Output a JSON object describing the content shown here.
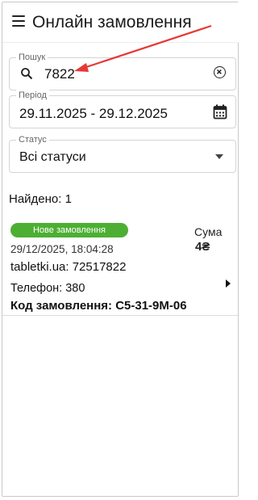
{
  "app": {
    "title": "Онлайн замовлення"
  },
  "search": {
    "label": "Пошук",
    "value": "7822"
  },
  "period": {
    "label": "Період",
    "value": "29.11.2025 - 29.12.2025"
  },
  "status": {
    "label": "Статус",
    "value": "Всі статуси"
  },
  "results": {
    "found_text": "Найдено: 1"
  },
  "orders": [
    {
      "badge": "Нове замовлення",
      "badge_color": "#4caf33",
      "datetime": "29/12/2025, 18:04:28",
      "source": "tabletki.ua: 72517822",
      "phone": "Телефон: 380",
      "code": "Код замовлення: C5-31-9M-06",
      "sum_label": "Сума",
      "sum_value": "4₴"
    }
  ],
  "colors": {
    "accent": "#4caf33",
    "annotation": "#e53935"
  },
  "icons": [
    "menu-icon",
    "search-icon",
    "clear-icon",
    "calendar-icon",
    "dropdown-icon",
    "chevron-right-icon"
  ]
}
